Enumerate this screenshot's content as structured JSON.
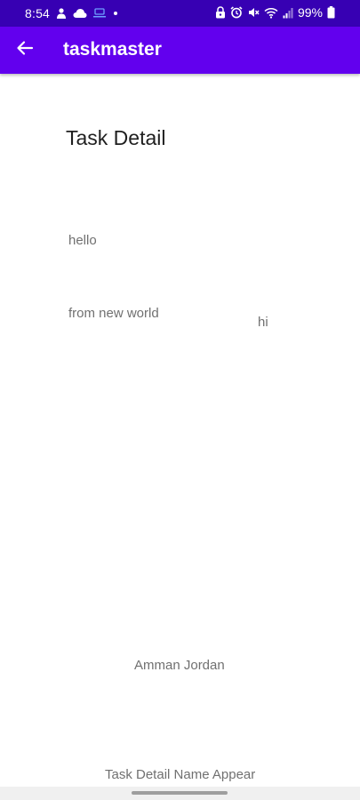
{
  "status_bar": {
    "time": "8:54",
    "battery": "99%",
    "left_icons": [
      "person-icon",
      "cloud-icon",
      "cast-icon",
      "dot-icon"
    ],
    "right_icons": [
      "lock-icon",
      "alarm-icon",
      "mute-icon",
      "wifi-icon",
      "signal-icon",
      "battery-icon"
    ],
    "background_color": "#3700b3"
  },
  "app_bar": {
    "title": "taskmaster",
    "back_icon": "arrow-back-icon",
    "background_color": "#6200ee"
  },
  "content": {
    "heading": "Task Detail",
    "text_hello": "hello",
    "text_body": "from new world",
    "text_state": "hi",
    "text_location": "Amman Jordan",
    "text_footer": "Task Detail Name Appear"
  },
  "nav_bar": {
    "handle_icon": "home-handle"
  }
}
